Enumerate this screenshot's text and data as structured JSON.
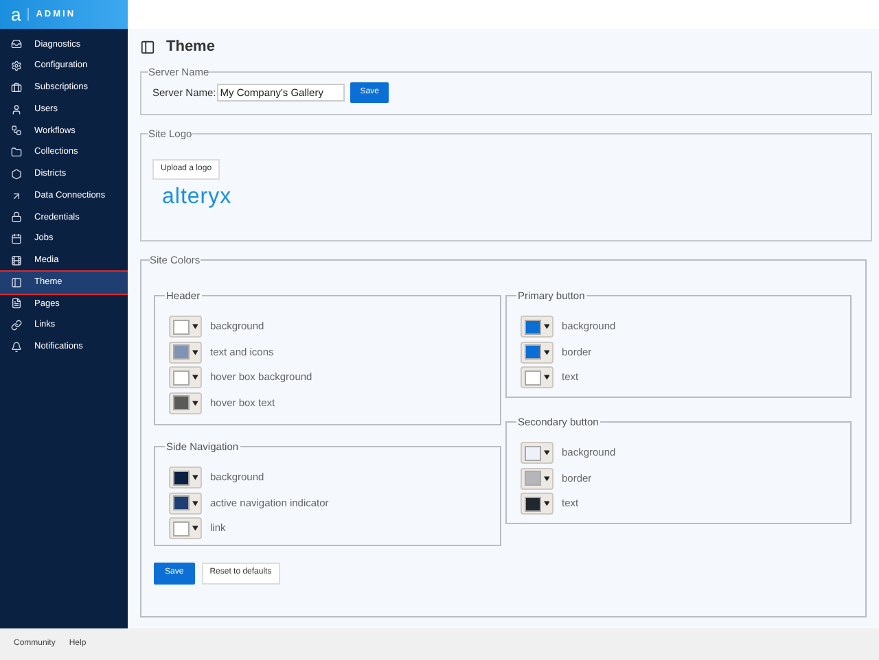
{
  "brand": {
    "letter": "a",
    "title": "ADMIN"
  },
  "sidebar": {
    "items": [
      {
        "label": "Diagnostics",
        "selected": false
      },
      {
        "label": "Configuration",
        "selected": false
      },
      {
        "label": "Subscriptions",
        "selected": false
      },
      {
        "label": "Users",
        "selected": false
      },
      {
        "label": "Workflows",
        "selected": false
      },
      {
        "label": "Collections",
        "selected": false
      },
      {
        "label": "Districts",
        "selected": false
      },
      {
        "label": "Data Connections",
        "selected": false
      },
      {
        "label": "Credentials",
        "selected": false
      },
      {
        "label": "Jobs",
        "selected": false
      },
      {
        "label": "Media",
        "selected": false
      },
      {
        "label": "Theme",
        "selected": true
      },
      {
        "label": "Pages",
        "selected": false
      },
      {
        "label": "Links",
        "selected": false
      },
      {
        "label": "Notifications",
        "selected": false
      }
    ]
  },
  "page": {
    "title": "Theme"
  },
  "server_name": {
    "legend": "Server Name",
    "label": "Server Name:",
    "value": "My Company's Gallery",
    "button": "Save"
  },
  "site_logo": {
    "legend": "Site Logo",
    "button": "Upload a logo",
    "logo": "alteryx"
  },
  "site_colors": {
    "legend": "Site Colors",
    "left": [
      {
        "legend": "Header",
        "items": [
          {
            "label": "background",
            "color": "#ffffff"
          },
          {
            "label": "text and icons",
            "color": "#7f93b5"
          },
          {
            "label": "hover box background",
            "color": "#ffffff"
          },
          {
            "label": "hover box text",
            "color": "#5a5a5a"
          }
        ]
      },
      {
        "legend": "Side Navigation",
        "items": [
          {
            "label": "background",
            "color": "#0b2142"
          },
          {
            "label": "active navigation indicator",
            "color": "#1f3f72"
          },
          {
            "label": "link",
            "color": "#ffffff"
          }
        ]
      }
    ],
    "right": [
      {
        "legend": "Primary button",
        "items": [
          {
            "label": "background",
            "color": "#0b6fd5"
          },
          {
            "label": "border",
            "color": "#0b6fd5"
          },
          {
            "label": "text",
            "color": "#ffffff"
          }
        ]
      },
      {
        "legend": "Secondary button",
        "items": [
          {
            "label": "background",
            "color": "#eef1f8"
          },
          {
            "label": "border",
            "color": "#b4b6ba"
          },
          {
            "label": "text",
            "color": "#22272f"
          }
        ]
      }
    ],
    "save": "Save",
    "reset": "Reset to defaults"
  },
  "footer": {
    "links": [
      "Community",
      "Help"
    ]
  }
}
